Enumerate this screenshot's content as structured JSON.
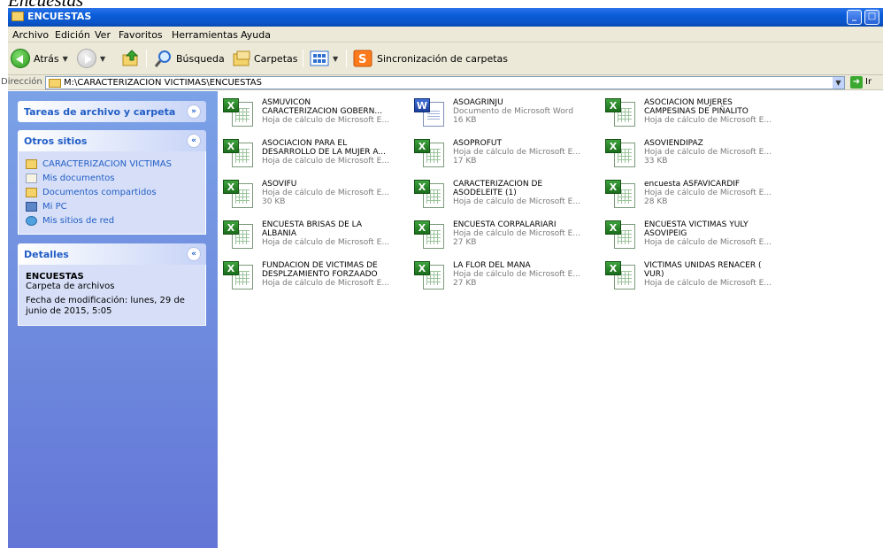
{
  "doc_heading": "Encuestas",
  "window": {
    "title": "ENCUESTAS",
    "controls": {
      "minimize": "_",
      "maximize": "□"
    }
  },
  "menu": [
    "Archivo",
    "Edición",
    "Ver",
    "Favoritos",
    "Herramientas",
    "Ayuda"
  ],
  "toolbar": {
    "back": "Atrás",
    "search": "Búsqueda",
    "folders": "Carpetas",
    "sync": "Sincronización de carpetas"
  },
  "address": {
    "label": "Dirección",
    "path": "M:\\CARACTERIZACION VICTIMAS\\ENCUESTAS",
    "go_label": "Ir"
  },
  "task_pane": {
    "tasks_title": "Tareas de archivo y carpeta",
    "other_places_title": "Otros sitios",
    "other_places": [
      {
        "label": "CARACTERIZACION VICTIMAS",
        "icon": "folder-icon"
      },
      {
        "label": "Mis documentos",
        "icon": "documents-icon"
      },
      {
        "label": "Documentos compartidos",
        "icon": "folder-icon"
      },
      {
        "label": "Mi PC",
        "icon": "computer-icon"
      },
      {
        "label": "Mis sitios de red",
        "icon": "network-icon"
      }
    ],
    "details_title": "Detalles",
    "details": {
      "name": "ENCUESTAS",
      "type": "Carpeta de archivos",
      "modified": "Fecha de modificación: lunes, 29 de junio de 2015, 5:05"
    }
  },
  "files": [
    {
      "name": "ASMUVICON\nCARACTERIZACION GOBERN...",
      "type": "Hoja de cálculo de Microsoft E...",
      "size": "",
      "kind": "excel"
    },
    {
      "name": "ASOAGRINJU",
      "type": "Documento de Microsoft Word",
      "size": "16 KB",
      "kind": "word"
    },
    {
      "name": "ASOCIACION MUJERES\nCAMPESINAS DE PIÑALITO",
      "type": "Hoja de cálculo de Microsoft E...",
      "size": "",
      "kind": "excel"
    },
    {
      "name": "ASOCIACION PARA EL\nDESARROLLO DE LA MUJER A...",
      "type": "Hoja de cálculo de Microsoft E...",
      "size": "",
      "kind": "excel"
    },
    {
      "name": "ASOPROFUT",
      "type": "Hoja de cálculo de Microsoft E...",
      "size": "17 KB",
      "kind": "excel"
    },
    {
      "name": "ASOVIENDIPAZ",
      "type": "Hoja de cálculo de Microsoft E...",
      "size": "33 KB",
      "kind": "excel"
    },
    {
      "name": "ASOVIFU",
      "type": "Hoja de cálculo de Microsoft E...",
      "size": "30 KB",
      "kind": "excel"
    },
    {
      "name": "CARACTERIZACION DE\nASODELEITE (1)",
      "type": "Hoja de cálculo de Microsoft E...",
      "size": "",
      "kind": "excel"
    },
    {
      "name": "encuesta ASFAVICARDIF",
      "type": "Hoja de cálculo de Microsoft E...",
      "size": "28 KB",
      "kind": "excel"
    },
    {
      "name": "ENCUESTA BRISAS DE LA\nALBANIA",
      "type": "Hoja de cálculo de Microsoft E...",
      "size": "",
      "kind": "excel"
    },
    {
      "name": "ENCUESTA CORPALARIARI",
      "type": "Hoja de cálculo de Microsoft E...",
      "size": "27 KB",
      "kind": "excel"
    },
    {
      "name": "ENCUESTA VICTIMAS YULY\nASOVIPEIG",
      "type": "Hoja de cálculo de Microsoft E...",
      "size": "",
      "kind": "excel"
    },
    {
      "name": "FUNDACION DE VICTIMAS DE\nDESPLZAMIENTO FORZAADO",
      "type": "Hoja de cálculo de Microsoft E...",
      "size": "",
      "kind": "excel"
    },
    {
      "name": "LA FLOR DEL MANA",
      "type": "Hoja de cálculo de Microsoft E...",
      "size": "27 KB",
      "kind": "excel"
    },
    {
      "name": "VICTIMAS UNIDAS RENACER (\nVUR)",
      "type": "Hoja de cálculo de Microsoft E...",
      "size": "",
      "kind": "excel"
    }
  ]
}
